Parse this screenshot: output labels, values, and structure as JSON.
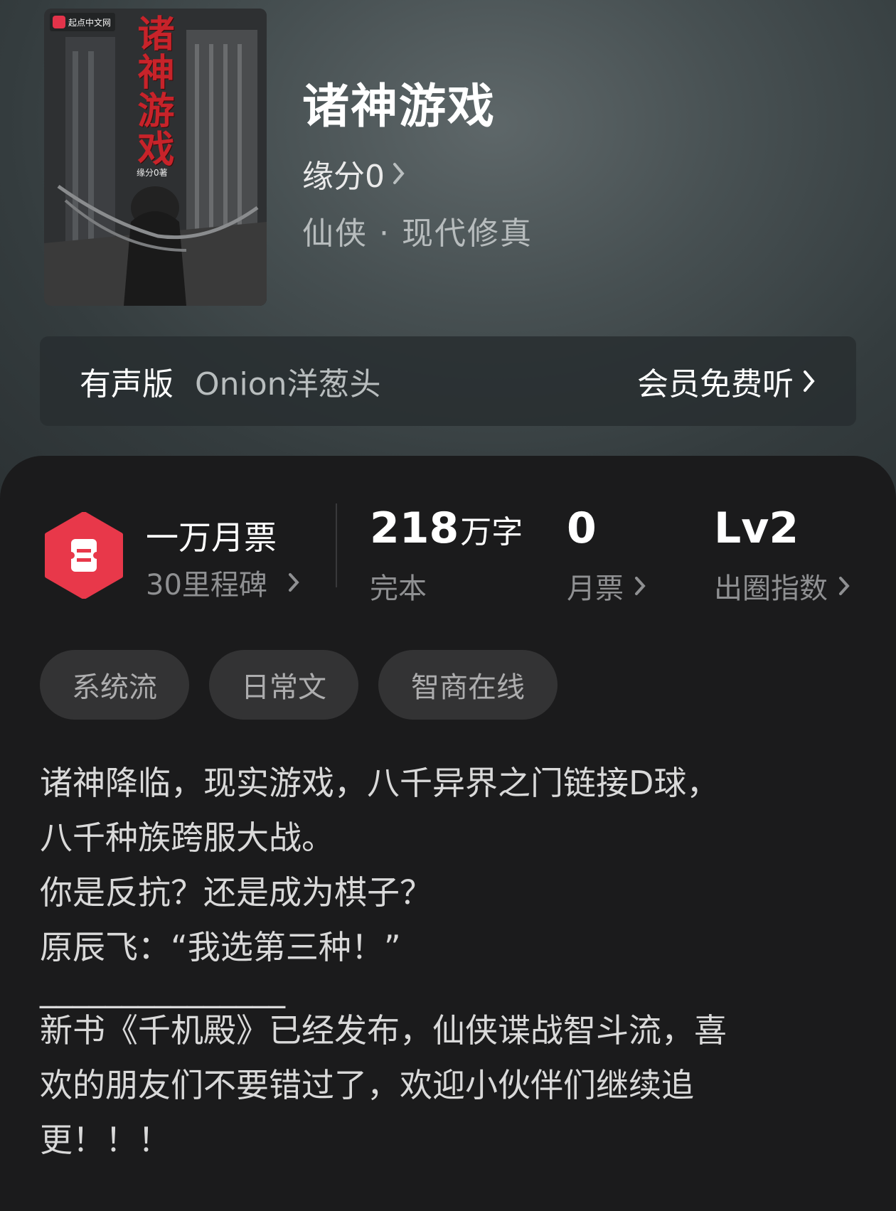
{
  "book": {
    "cover": {
      "publisher": "起点中文网",
      "title": "诸神游戏",
      "author": "缘分0著"
    },
    "title": "诸神游戏",
    "author": "缘分0",
    "genre": "仙侠 · 现代修真"
  },
  "audio": {
    "label": "有声版",
    "narrator": "Onion洋葱头",
    "cta": "会员免费听"
  },
  "stats": {
    "milestone": {
      "title": "一万月票",
      "sub": "30里程碑"
    },
    "words": {
      "value": "218",
      "unit": "万字",
      "label": "完本"
    },
    "monthly_tickets": {
      "value": "0",
      "label": "月票"
    },
    "level": {
      "value": "Lv2",
      "label": "出圈指数"
    }
  },
  "tags": [
    "系统流",
    "日常文",
    "智商在线"
  ],
  "description": [
    "诸神降临，现实游戏，八千异界之门链接D球，",
    "八千种族跨服大战。",
    "你是反抗？还是成为棋子？",
    "原辰飞：“我选第三种！”",
    "",
    "_______________",
    "新书《千机殿》已经发布，仙侠谍战智斗流，喜",
    "欢的朋友们不要错过了，欢迎小伙伴们继续追",
    "更！！！"
  ],
  "colors": {
    "accent_red": "#e8384a",
    "header_bg": "#475052",
    "card_bg": "#1b1b1c",
    "tag_bg": "#333334"
  }
}
